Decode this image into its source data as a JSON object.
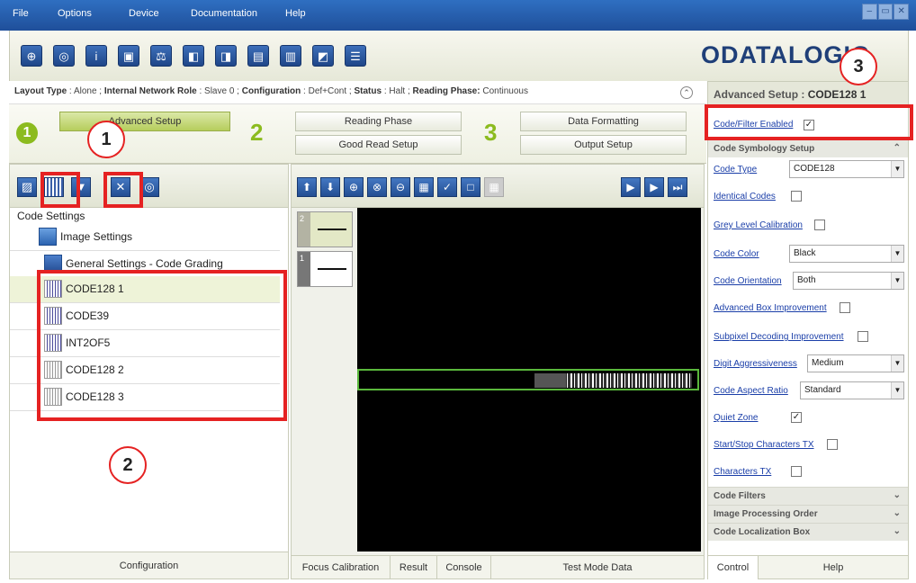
{
  "menu": {
    "items": [
      "File",
      "Options",
      "Device",
      "Documentation",
      "Help"
    ]
  },
  "window_controls": [
    "–",
    "▭",
    "✕"
  ],
  "logo": "ODATALOGIC",
  "status": {
    "layout_type_label": "Layout Type",
    "layout_type": "Alone",
    "network_role_label": "Internal Network Role",
    "network_role": "Slave 0",
    "configuration_label": "Configuration",
    "configuration": "Def+Cont",
    "status_label": "Status",
    "status": "Halt",
    "phase_label": "Reading Phase:",
    "phase": "Continuous"
  },
  "steps": {
    "s1": {
      "num": "1",
      "label": "Advanced Setup"
    },
    "s2": {
      "num": "2",
      "labels": [
        "Reading Phase",
        "Good Read Setup"
      ]
    },
    "s3": {
      "num": "3",
      "labels": [
        "Data Formatting",
        "Output Setup"
      ]
    }
  },
  "tree": {
    "root": "Code Settings",
    "image_settings": "Image Settings",
    "general": "General Settings - Code Grading",
    "codes": [
      "CODE128 1",
      "CODE39",
      "INT2OF5",
      "CODE128 2",
      "CODE128 3"
    ]
  },
  "config_footer": "Configuration",
  "center_tabs": [
    "Focus Calibration",
    "Result",
    "Console",
    "Test Mode Data"
  ],
  "thumbs": [
    "2",
    "1"
  ],
  "right": {
    "title_prefix": "Advanced Setup :",
    "title_code": "CODE128 1",
    "code_filter_enabled": "Code/Filter Enabled",
    "section_symbology": "Code Symbology Setup",
    "props": {
      "code_type": "Code Type",
      "code_type_value": "CODE128",
      "identical_codes": "Identical Codes",
      "grey_level": "Grey Level Calibration",
      "code_color": "Code Color",
      "code_color_value": "Black",
      "code_orientation": "Code Orientation",
      "code_orientation_value": "Both",
      "adv_box": "Advanced Box Improvement",
      "subpixel": "Subpixel Decoding Improvement",
      "digit_aggr": "Digit Aggressiveness",
      "digit_aggr_value": "Medium",
      "aspect_ratio": "Code Aspect Ratio",
      "aspect_ratio_value": "Standard",
      "quiet_zone": "Quiet Zone",
      "startstop": "Start/Stop Characters TX",
      "chars_tx": "Characters TX"
    },
    "sections": [
      "Code Filters",
      "Image Processing Order",
      "Code Localization Box"
    ],
    "tabs": [
      "Control",
      "Help"
    ]
  },
  "callouts": [
    "1",
    "2",
    "3"
  ],
  "colors": {
    "accent_green": "#8cbb1f",
    "annotation_red": "#e52222",
    "link_blue": "#1a3ea8"
  }
}
